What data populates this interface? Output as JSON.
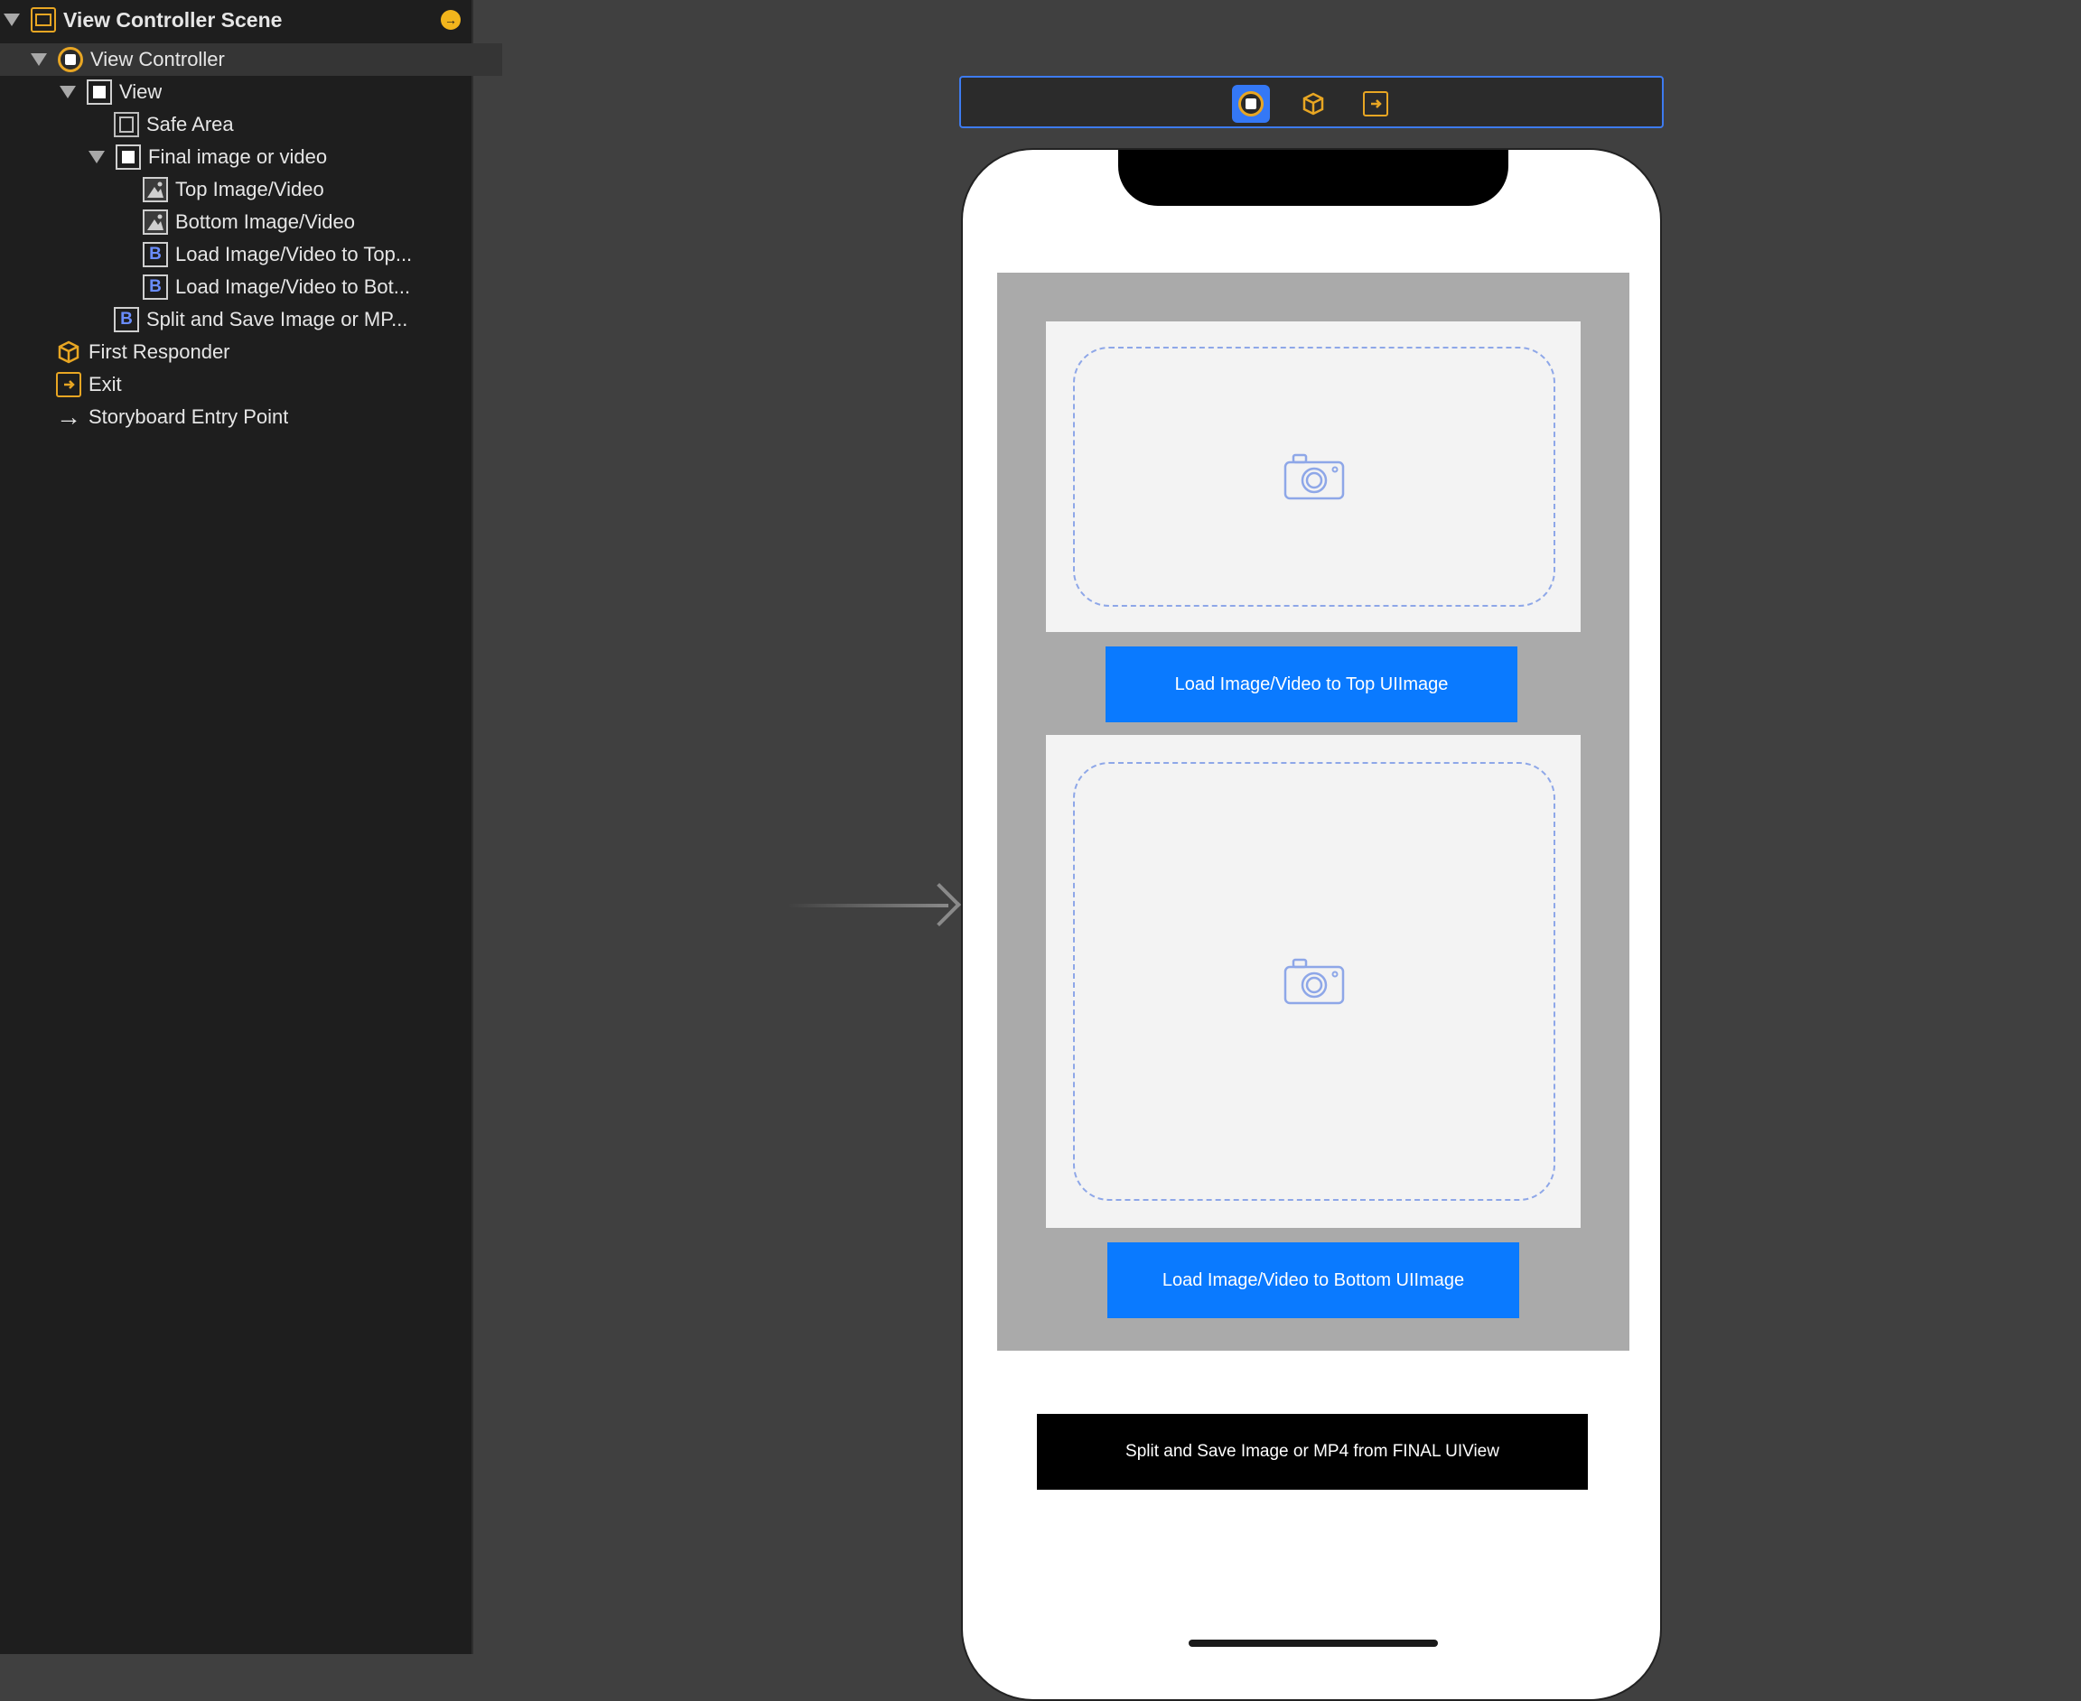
{
  "outline": {
    "scene_title": "View Controller Scene",
    "items": [
      {
        "label": "View Controller",
        "icon": "view-controller-icon"
      },
      {
        "label": "View",
        "icon": "view-icon"
      },
      {
        "label": "Safe Area",
        "icon": "safe-area-icon"
      },
      {
        "label": "Final image or video",
        "icon": "view-icon"
      },
      {
        "label": "Top Image/Video",
        "icon": "image-view-icon"
      },
      {
        "label": "Bottom Image/Video",
        "icon": "image-view-icon"
      },
      {
        "label": "Load Image/Video to Top...",
        "icon": "button-icon"
      },
      {
        "label": "Load Image/Video to Bot...",
        "icon": "button-icon"
      },
      {
        "label": "Split and Save Image or MP...",
        "icon": "button-icon"
      },
      {
        "label": "First Responder",
        "icon": "first-responder-icon"
      },
      {
        "label": "Exit",
        "icon": "exit-icon"
      },
      {
        "label": "Storyboard Entry Point",
        "icon": "arrow-right-icon"
      }
    ],
    "button_glyph": "B"
  },
  "canvas": {
    "top_button": "Load Image/Video to Top UIImage",
    "bottom_button": "Load Image/Video to Bottom UIImage",
    "save_button": "Split and Save Image or MP4 from FINAL UIView"
  },
  "colors": {
    "accent": "#0a7aff",
    "selection": "#3478f6",
    "object_icon": "#e8a623"
  }
}
